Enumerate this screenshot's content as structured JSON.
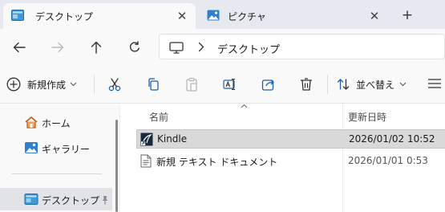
{
  "tabs": [
    {
      "label": "デスクトップ",
      "icon": "desktop-folder-icon",
      "active": true
    },
    {
      "label": "ピクチャ",
      "icon": "pictures-icon",
      "active": false
    }
  ],
  "tab_close_glyph": "✕",
  "new_tab_glyph": "+",
  "address": {
    "crumb": "デスクトップ"
  },
  "commands": {
    "new_label": "新規作成",
    "sort_label": "並べ替え"
  },
  "nav_pane": {
    "items": [
      {
        "label": "ホーム",
        "icon": "home-icon"
      },
      {
        "label": "ギャラリー",
        "icon": "gallery-icon"
      },
      {
        "label": "デスクトップ",
        "icon": "desktop-folder-icon",
        "selected": true
      }
    ]
  },
  "file_list": {
    "columns": {
      "name": "名前",
      "date": "更新日時"
    },
    "rows": [
      {
        "name": "Kindle",
        "date": "2026/01/02 10:52",
        "icon": "kindle-shortcut-icon",
        "selected": true
      },
      {
        "name": "新規 テキスト ドキュメント",
        "date": "2026/01/01 0:53",
        "icon": "text-document-icon",
        "selected": false
      }
    ]
  },
  "colors": {
    "tabstrip_bg": "#e6eaf0",
    "chrome_bg": "#f9f9f9",
    "accent": "#0067c0",
    "selected_row": "#d9d9d9"
  }
}
